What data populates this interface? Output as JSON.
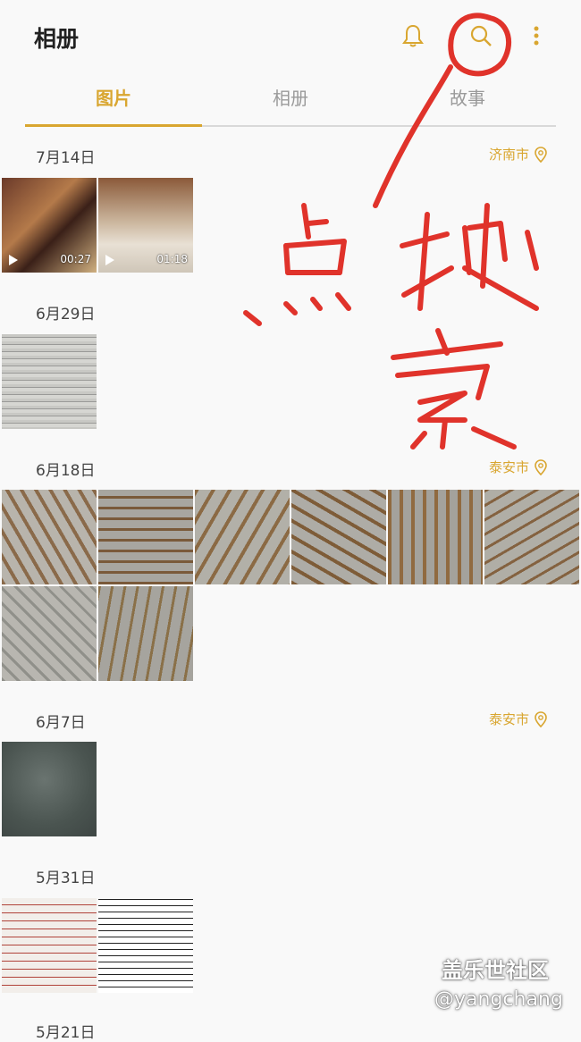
{
  "header": {
    "title": "相册"
  },
  "icons": {
    "bell": "bell-icon",
    "search": "search-icon",
    "more": "more-vert-icon",
    "location": "location-pin-icon"
  },
  "tabs": [
    {
      "label": "图片",
      "active": true
    },
    {
      "label": "相册",
      "active": false
    },
    {
      "label": "故事",
      "active": false
    }
  ],
  "groups": [
    {
      "date": "7月14日",
      "location": "济南市"
    },
    {
      "date": "6月29日",
      "location": ""
    },
    {
      "date": "6月18日",
      "location": "泰安市"
    },
    {
      "date": "6月7日",
      "location": "泰安市"
    },
    {
      "date": "5月31日",
      "location": ""
    },
    {
      "date": "5月21日",
      "location": ""
    }
  ],
  "videos": [
    {
      "duration": "00:27"
    },
    {
      "duration": "01:18"
    }
  ],
  "annotation": {
    "text": "点搜索",
    "color": "#e0332b"
  },
  "watermark": {
    "line1": "盖乐世社区",
    "line2": "@yangchang"
  },
  "colors": {
    "accent": "#d9a630",
    "background": "#f9f9f9"
  }
}
